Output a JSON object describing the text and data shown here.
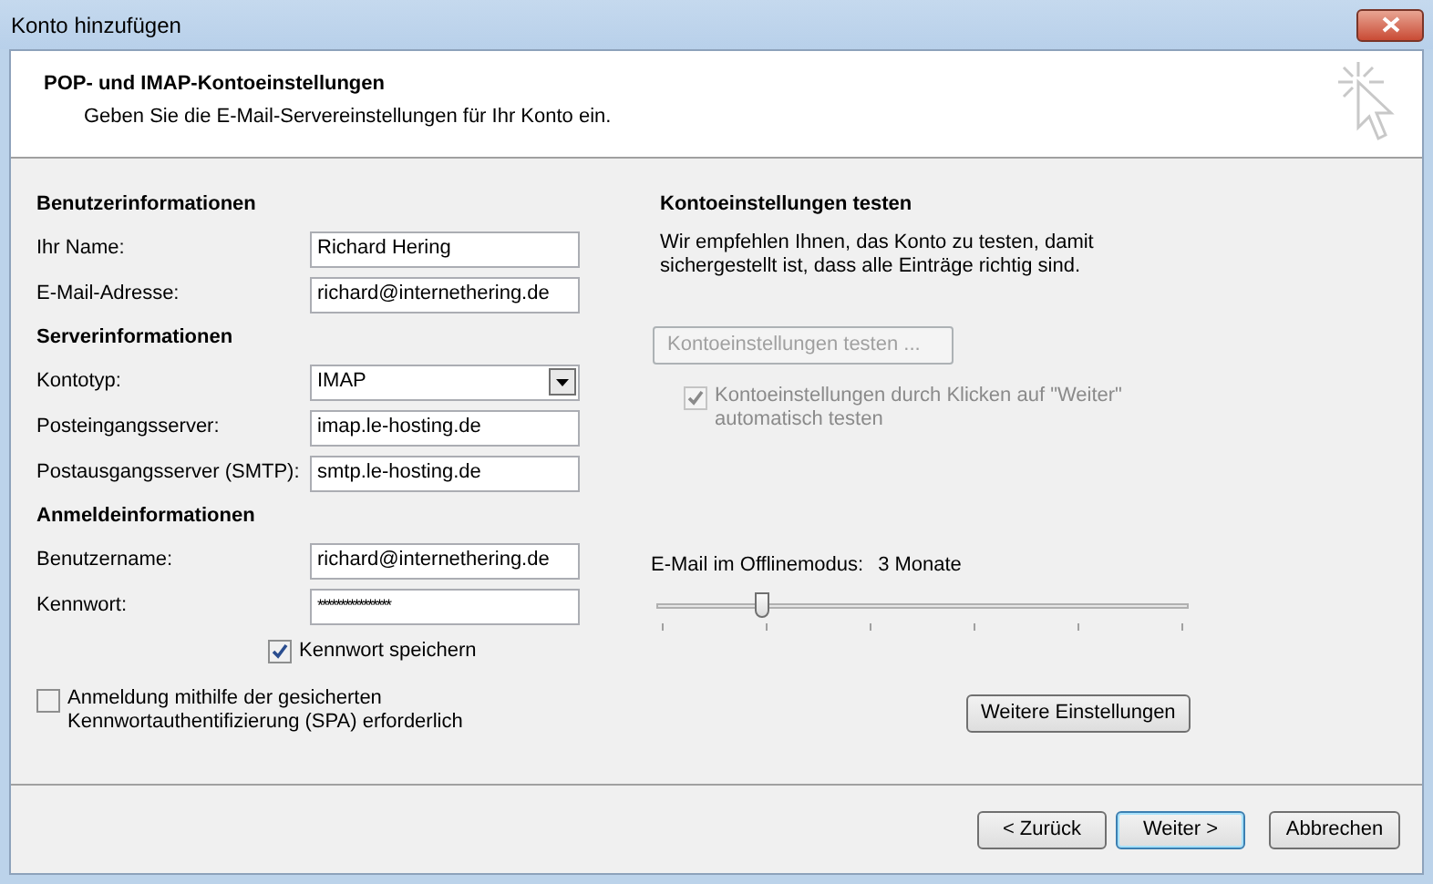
{
  "window": {
    "title": "Konto hinzufügen"
  },
  "header": {
    "title": "POP- und IMAP-Kontoeinstellungen",
    "subtitle": "Geben Sie die E-Mail-Servereinstellungen für Ihr Konto ein."
  },
  "sections": [
    {
      "heading": "Benutzerinformationen",
      "fields": [
        {
          "label": "Ihr Name:",
          "value": "Richard Hering",
          "kind": "text"
        },
        {
          "label": "E-Mail-Adresse:",
          "value": "richard@internethering.de",
          "kind": "text"
        }
      ]
    },
    {
      "heading": "Serverinformationen",
      "fields": [
        {
          "label": "Kontotyp:",
          "value": "IMAP",
          "kind": "dropdown"
        },
        {
          "label": "Posteingangsserver:",
          "value": "imap.le-hosting.de",
          "kind": "text"
        },
        {
          "label": "Postausgangsserver (SMTP):",
          "value": "smtp.le-hosting.de",
          "kind": "text"
        }
      ]
    },
    {
      "heading": "Anmeldeinformationen",
      "fields": [
        {
          "label": "Benutzername:",
          "value": "richard@internethering.de",
          "kind": "text"
        },
        {
          "label": "Kennwort:",
          "value": "****************",
          "kind": "password"
        }
      ]
    }
  ],
  "save_password": {
    "label": "Kennwort speichern",
    "checked": true
  },
  "spa": {
    "label": "Anmeldung mithilfe der gesicherten Kennwortauthentifizierung (SPA) erforderlich",
    "checked": false
  },
  "test": {
    "heading": "Kontoeinstellungen testen",
    "description": "Wir empfehlen Ihnen, das Konto zu testen, damit sichergestellt ist, dass alle Einträge richtig sind.",
    "button": {
      "label": "Kontoeinstellungen testen ...",
      "disabled": true
    },
    "auto_test": {
      "label": "Kontoeinstellungen durch Klicken auf \"Weiter\" automatisch testen",
      "checked": true,
      "disabled": true
    }
  },
  "offline": {
    "label": "E-Mail im Offlinemodus:",
    "value": "3 Monate",
    "level": 0.2
  },
  "more_button": "Weitere Einstellungen",
  "buttons": [
    {
      "label": "< Zurück",
      "default": false
    },
    {
      "label": "Weiter >",
      "default": true
    },
    {
      "label": "Abbrechen",
      "default": false
    }
  ]
}
